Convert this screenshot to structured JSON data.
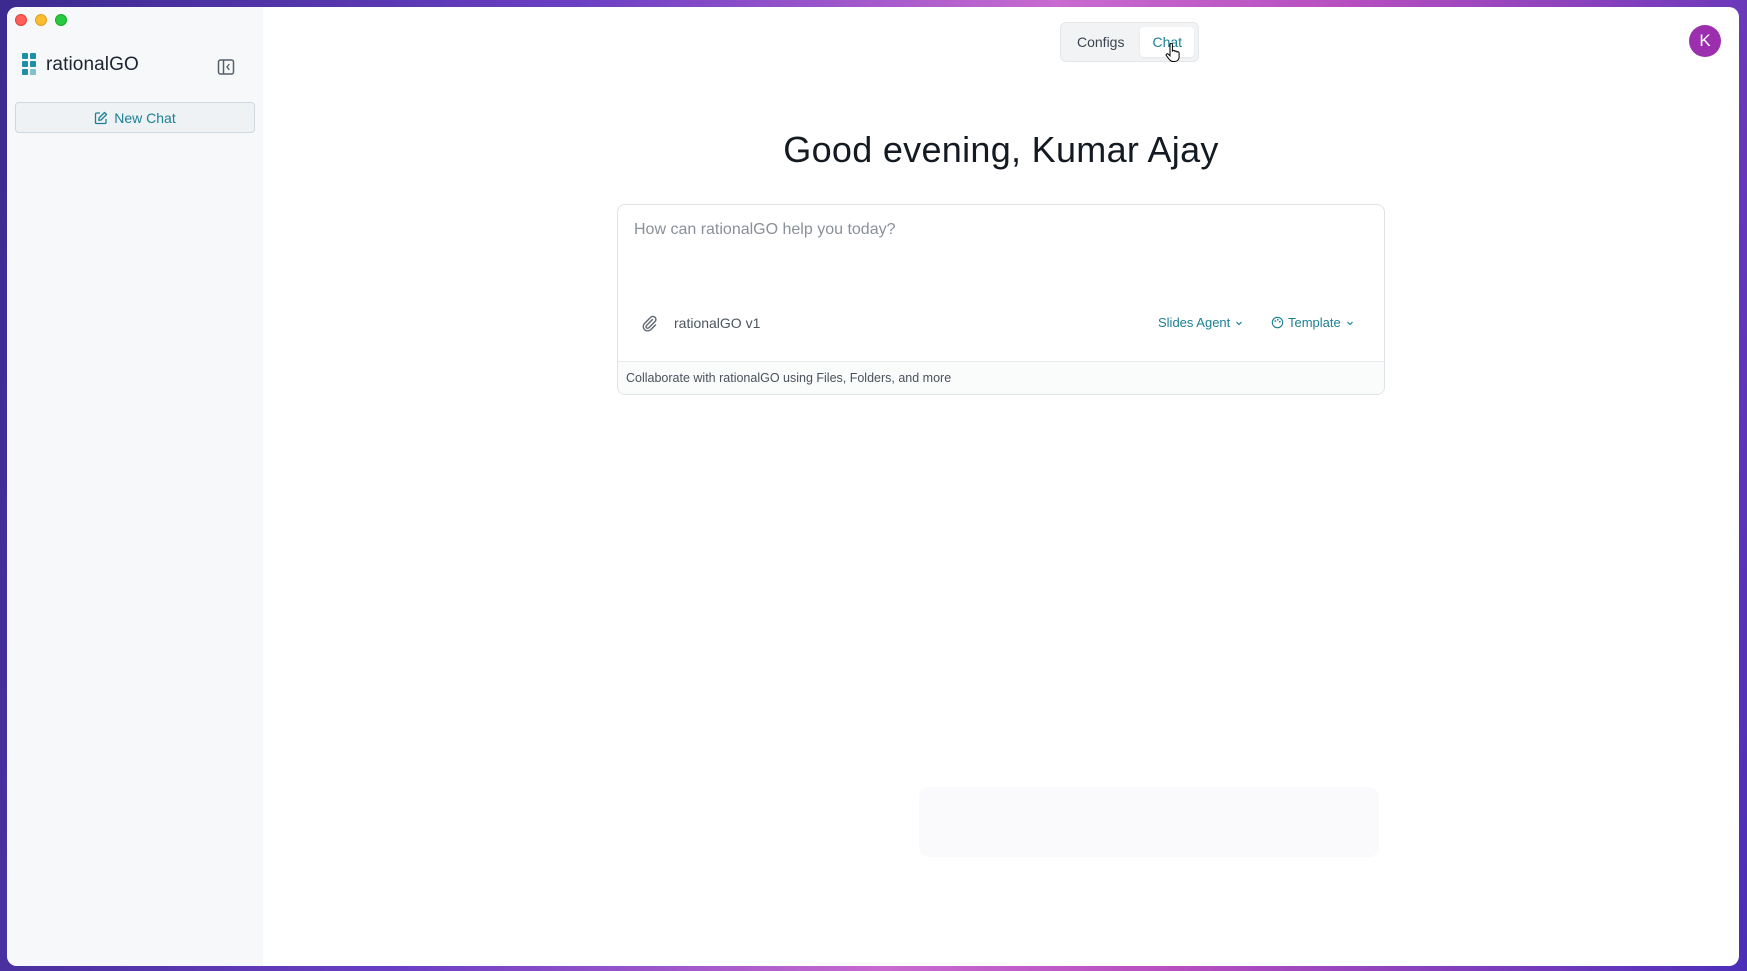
{
  "sidebar": {
    "brand": "rationalGO",
    "new_chat_label": "New Chat"
  },
  "header": {
    "tabs": [
      {
        "label": "Configs",
        "active": false
      },
      {
        "label": "Chat",
        "active": true
      }
    ],
    "avatar_initial": "K"
  },
  "main": {
    "greeting": "Good evening, Kumar Ajay",
    "composer": {
      "placeholder": "How can rationalGO help you today?",
      "model": "rationalGO v1",
      "agent": "Slides Agent",
      "template": "Template",
      "footer": "Collaborate with rationalGO using Files, Folders, and more"
    }
  },
  "colors": {
    "accent": "#1c7f93",
    "avatar": "#9b2fae"
  }
}
